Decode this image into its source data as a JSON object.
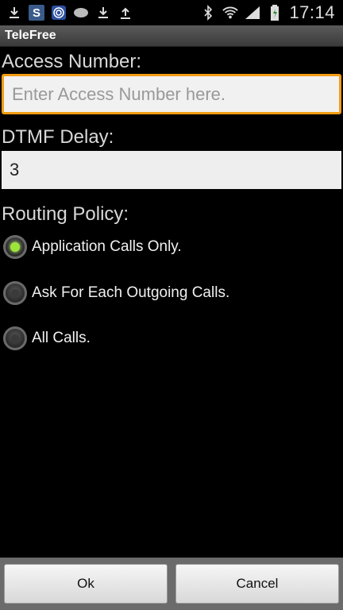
{
  "status_bar": {
    "left_icons": [
      "download-icon",
      "s-app-icon",
      "fingerprint-app-icon",
      "chat-bubble-icon",
      "download-icon",
      "upload-icon"
    ],
    "s_badge": "S",
    "right_icons": [
      "bluetooth-icon",
      "wifi-icon",
      "signal-icon",
      "battery-icon"
    ],
    "time": "17:14"
  },
  "title_bar": {
    "title": "TeleFree"
  },
  "form": {
    "access_number": {
      "label": "Access Number:",
      "placeholder": "Enter Access Number here.",
      "value": ""
    },
    "dtmf_delay": {
      "label": "DTMF Delay:",
      "value": "3"
    },
    "routing_policy": {
      "label": "Routing Policy:",
      "options": [
        {
          "label": "Application Calls Only.",
          "checked": true
        },
        {
          "label": "Ask For Each Outgoing Calls.",
          "checked": false
        },
        {
          "label": "All Calls.",
          "checked": false
        }
      ]
    }
  },
  "buttons": {
    "ok": "Ok",
    "cancel": "Cancel"
  },
  "colors": {
    "focus_border": "#f39c12",
    "radio_checked": "#9ee53a",
    "title_bar": "#4a4a4a"
  }
}
